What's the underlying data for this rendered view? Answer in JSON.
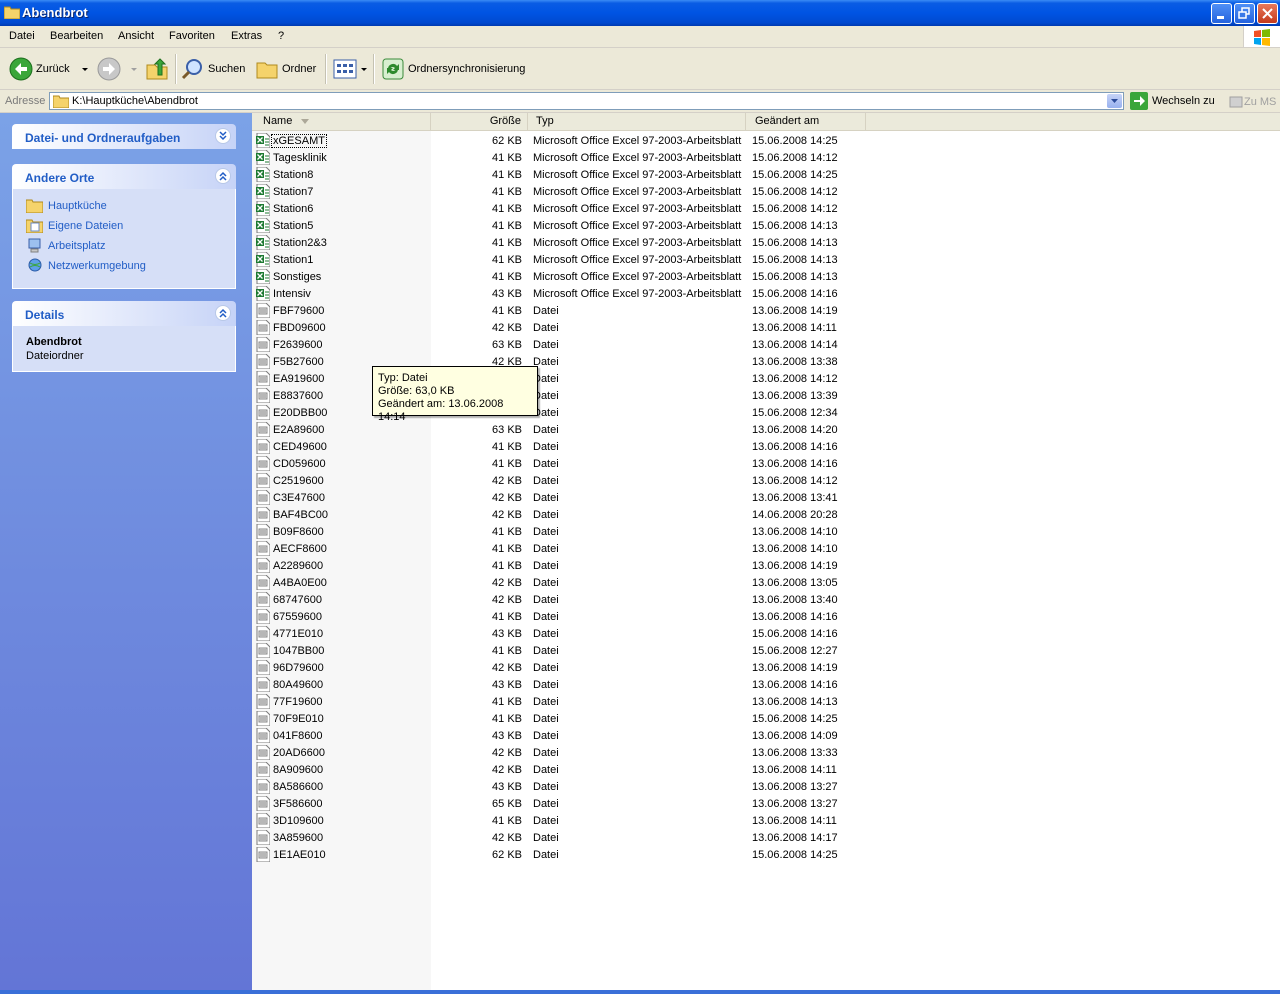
{
  "window": {
    "title": "Abendbrot"
  },
  "menu": [
    "Datei",
    "Bearbeiten",
    "Ansicht",
    "Favoriten",
    "Extras",
    "?"
  ],
  "toolbar": {
    "back": "Zurück",
    "search": "Suchen",
    "folders": "Ordner",
    "sync": "Ordnersynchronisierung"
  },
  "address": {
    "label": "Adresse",
    "value": "K:\\Hauptküche\\Abendbrot",
    "go": "Wechseln zu",
    "links": "Zu MS"
  },
  "tasks": {
    "file_folder": {
      "title": "Datei- und Ordneraufgaben"
    },
    "other_places": {
      "title": "Andere Orte",
      "items": [
        "Hauptküche",
        "Eigene Dateien",
        "Arbeitsplatz",
        "Netzwerkumgebung"
      ]
    },
    "details": {
      "title": "Details",
      "name": "Abendbrot",
      "kind": "Dateiordner"
    }
  },
  "columns": {
    "name": "Name",
    "size": "Größe",
    "type": "Typ",
    "modified": "Geändert am"
  },
  "files": [
    {
      "name": "xGESAMT",
      "size": "62 KB",
      "type": "Microsoft Office Excel 97-2003-Arbeitsblatt",
      "modified": "15.06.2008 14:25",
      "excel": true
    },
    {
      "name": "Tagesklinik",
      "size": "41 KB",
      "type": "Microsoft Office Excel 97-2003-Arbeitsblatt",
      "modified": "15.06.2008 14:12",
      "excel": true
    },
    {
      "name": "Station8",
      "size": "41 KB",
      "type": "Microsoft Office Excel 97-2003-Arbeitsblatt",
      "modified": "15.06.2008 14:25",
      "excel": true
    },
    {
      "name": "Station7",
      "size": "41 KB",
      "type": "Microsoft Office Excel 97-2003-Arbeitsblatt",
      "modified": "15.06.2008 14:12",
      "excel": true
    },
    {
      "name": "Station6",
      "size": "41 KB",
      "type": "Microsoft Office Excel 97-2003-Arbeitsblatt",
      "modified": "15.06.2008 14:12",
      "excel": true
    },
    {
      "name": "Station5",
      "size": "41 KB",
      "type": "Microsoft Office Excel 97-2003-Arbeitsblatt",
      "modified": "15.06.2008 14:13",
      "excel": true
    },
    {
      "name": "Station2&3",
      "size": "41 KB",
      "type": "Microsoft Office Excel 97-2003-Arbeitsblatt",
      "modified": "15.06.2008 14:13",
      "excel": true
    },
    {
      "name": "Station1",
      "size": "41 KB",
      "type": "Microsoft Office Excel 97-2003-Arbeitsblatt",
      "modified": "15.06.2008 14:13",
      "excel": true
    },
    {
      "name": "Sonstiges",
      "size": "41 KB",
      "type": "Microsoft Office Excel 97-2003-Arbeitsblatt",
      "modified": "15.06.2008 14:13",
      "excel": true
    },
    {
      "name": "Intensiv",
      "size": "43 KB",
      "type": "Microsoft Office Excel 97-2003-Arbeitsblatt",
      "modified": "15.06.2008 14:16",
      "excel": true
    },
    {
      "name": "FBF79600",
      "size": "41 KB",
      "type": "Datei",
      "modified": "13.06.2008 14:19",
      "excel": false
    },
    {
      "name": "FBD09600",
      "size": "42 KB",
      "type": "Datei",
      "modified": "13.06.2008 14:11",
      "excel": false
    },
    {
      "name": "F2639600",
      "size": "63 KB",
      "type": "Datei",
      "modified": "13.06.2008 14:14",
      "excel": false
    },
    {
      "name": "F5B27600",
      "size": "42 KB",
      "type": "Datei",
      "modified": "13.06.2008 13:38",
      "excel": false
    },
    {
      "name": "EA919600",
      "size": "",
      "type": "Datei",
      "modified": "13.06.2008 14:12",
      "excel": false
    },
    {
      "name": "E8837600",
      "size": "",
      "type": "Datei",
      "modified": "13.06.2008 13:39",
      "excel": false
    },
    {
      "name": "E20DBB00",
      "size": "",
      "type": "Datei",
      "modified": "15.06.2008 12:34",
      "excel": false
    },
    {
      "name": "E2A89600",
      "size": "63 KB",
      "type": "Datei",
      "modified": "13.06.2008 14:20",
      "excel": false
    },
    {
      "name": "CED49600",
      "size": "41 KB",
      "type": "Datei",
      "modified": "13.06.2008 14:16",
      "excel": false
    },
    {
      "name": "CD059600",
      "size": "41 KB",
      "type": "Datei",
      "modified": "13.06.2008 14:16",
      "excel": false
    },
    {
      "name": "C2519600",
      "size": "42 KB",
      "type": "Datei",
      "modified": "13.06.2008 14:12",
      "excel": false
    },
    {
      "name": "C3E47600",
      "size": "42 KB",
      "type": "Datei",
      "modified": "13.06.2008 13:41",
      "excel": false
    },
    {
      "name": "BAF4BC00",
      "size": "42 KB",
      "type": "Datei",
      "modified": "14.06.2008 20:28",
      "excel": false
    },
    {
      "name": "B09F8600",
      "size": "41 KB",
      "type": "Datei",
      "modified": "13.06.2008 14:10",
      "excel": false
    },
    {
      "name": "AECF8600",
      "size": "41 KB",
      "type": "Datei",
      "modified": "13.06.2008 14:10",
      "excel": false
    },
    {
      "name": "A2289600",
      "size": "41 KB",
      "type": "Datei",
      "modified": "13.06.2008 14:19",
      "excel": false
    },
    {
      "name": "A4BA0E00",
      "size": "42 KB",
      "type": "Datei",
      "modified": "13.06.2008 13:05",
      "excel": false
    },
    {
      "name": "68747600",
      "size": "42 KB",
      "type": "Datei",
      "modified": "13.06.2008 13:40",
      "excel": false
    },
    {
      "name": "67559600",
      "size": "41 KB",
      "type": "Datei",
      "modified": "13.06.2008 14:16",
      "excel": false
    },
    {
      "name": "4771E010",
      "size": "43 KB",
      "type": "Datei",
      "modified": "15.06.2008 14:16",
      "excel": false
    },
    {
      "name": "1047BB00",
      "size": "41 KB",
      "type": "Datei",
      "modified": "15.06.2008 12:27",
      "excel": false
    },
    {
      "name": "96D79600",
      "size": "42 KB",
      "type": "Datei",
      "modified": "13.06.2008 14:19",
      "excel": false
    },
    {
      "name": "80A49600",
      "size": "43 KB",
      "type": "Datei",
      "modified": "13.06.2008 14:16",
      "excel": false
    },
    {
      "name": "77F19600",
      "size": "41 KB",
      "type": "Datei",
      "modified": "13.06.2008 14:13",
      "excel": false
    },
    {
      "name": "70F9E010",
      "size": "41 KB",
      "type": "Datei",
      "modified": "15.06.2008 14:25",
      "excel": false
    },
    {
      "name": "041F8600",
      "size": "43 KB",
      "type": "Datei",
      "modified": "13.06.2008 14:09",
      "excel": false
    },
    {
      "name": "20AD6600",
      "size": "42 KB",
      "type": "Datei",
      "modified": "13.06.2008 13:33",
      "excel": false
    },
    {
      "name": "8A909600",
      "size": "42 KB",
      "type": "Datei",
      "modified": "13.06.2008 14:11",
      "excel": false
    },
    {
      "name": "8A586600",
      "size": "43 KB",
      "type": "Datei",
      "modified": "13.06.2008 13:27",
      "excel": false
    },
    {
      "name": "3F586600",
      "size": "65 KB",
      "type": "Datei",
      "modified": "13.06.2008 13:27",
      "excel": false
    },
    {
      "name": "3D109600",
      "size": "41 KB",
      "type": "Datei",
      "modified": "13.06.2008 14:11",
      "excel": false
    },
    {
      "name": "3A859600",
      "size": "42 KB",
      "type": "Datei",
      "modified": "13.06.2008 14:17",
      "excel": false
    },
    {
      "name": "1E1AE010",
      "size": "62 KB",
      "type": "Datei",
      "modified": "15.06.2008 14:25",
      "excel": false
    }
  ],
  "tooltip": {
    "line1": "Typ: Datei",
    "line2": "Größe: 63,0 KB",
    "line3": "Geändert am: 13.06.2008 14:14"
  }
}
